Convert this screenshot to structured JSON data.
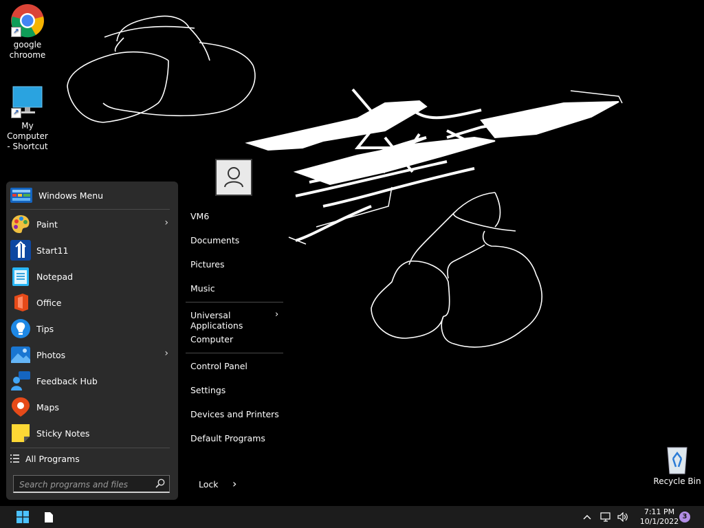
{
  "desktop": {
    "icons": [
      {
        "label": "google\nchroome",
        "icon": "chrome-icon"
      },
      {
        "label": "My Computer\n- Shortcut",
        "icon": "monitor-icon"
      },
      {
        "label": "Recycle Bin",
        "icon": "recycle-bin-icon"
      }
    ]
  },
  "start_menu": {
    "header": "Windows Menu",
    "apps": [
      {
        "label": "Paint",
        "icon": "paint-icon",
        "has_submenu": true
      },
      {
        "label": "Start11",
        "icon": "start11-icon",
        "has_submenu": false
      },
      {
        "label": "Notepad",
        "icon": "notepad-icon",
        "has_submenu": false
      },
      {
        "label": "Office",
        "icon": "office-icon",
        "has_submenu": false
      },
      {
        "label": "Tips",
        "icon": "tips-icon",
        "has_submenu": false
      },
      {
        "label": "Photos",
        "icon": "photos-icon",
        "has_submenu": true
      },
      {
        "label": "Feedback Hub",
        "icon": "feedback-hub-icon",
        "has_submenu": false
      },
      {
        "label": "Maps",
        "icon": "maps-icon",
        "has_submenu": false
      },
      {
        "label": "Sticky Notes",
        "icon": "sticky-notes-icon",
        "has_submenu": false
      }
    ],
    "all_programs": "All Programs",
    "search_placeholder": "Search programs and files",
    "places": [
      "VM6",
      "Documents",
      "Pictures",
      "Music",
      "Universal Applications",
      "Computer",
      "Control Panel",
      "Settings",
      "Devices and Printers",
      "Default Programs"
    ],
    "lock": "Lock"
  },
  "taskbar": {
    "time": "7:11 PM",
    "date": "10/1/2022",
    "notification_count": "3"
  },
  "colors": {
    "menu_bg": "#2b2b2b",
    "taskbar_bg": "#1c1c1c",
    "accent": "#0078d4"
  }
}
